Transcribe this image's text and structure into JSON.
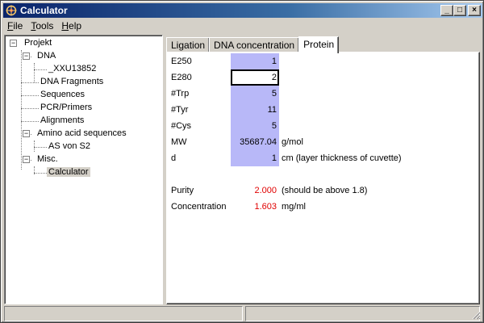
{
  "window": {
    "title": "Calculator",
    "app_icon": "calculator-app-icon"
  },
  "title_buttons": {
    "minimize": "_",
    "maximize": "□",
    "close": "×"
  },
  "menu": [
    {
      "label": "File",
      "accel": "F",
      "rest": "ile"
    },
    {
      "label": "Tools",
      "accel": "T",
      "rest": "ools"
    },
    {
      "label": "Help",
      "accel": "H",
      "rest": "elp"
    }
  ],
  "tree": {
    "expander_open": "−",
    "items": [
      {
        "label": "Projekt"
      },
      {
        "label": "DNA"
      },
      {
        "label": "_XXU13852"
      },
      {
        "label": "DNA Fragments"
      },
      {
        "label": "Sequences"
      },
      {
        "label": "PCR/Primers"
      },
      {
        "label": "Alignments"
      },
      {
        "label": "Amino acid sequences"
      },
      {
        "label": "AS von S2"
      },
      {
        "label": "Misc."
      },
      {
        "label": "Calculator"
      }
    ]
  },
  "tabs": [
    {
      "label": "Ligation"
    },
    {
      "label": "DNA concentration"
    },
    {
      "label": "Protein"
    }
  ],
  "protein": {
    "params": [
      {
        "label": "E250",
        "value": "1",
        "unit": ""
      },
      {
        "label": "E280",
        "value": "2",
        "unit": ""
      },
      {
        "label": "#Trp",
        "value": "5",
        "unit": ""
      },
      {
        "label": "#Tyr",
        "value": "11",
        "unit": ""
      },
      {
        "label": "#Cys",
        "value": "5",
        "unit": ""
      },
      {
        "label": "MW",
        "value": "35687.04",
        "unit": "g/mol"
      },
      {
        "label": "d",
        "value": "1",
        "unit": "cm (layer thickness of cuvette)"
      }
    ],
    "results": [
      {
        "label": "Purity",
        "value": "2.000",
        "note": "(should be above 1.8)"
      },
      {
        "label": "Concentration",
        "value": "1.603",
        "note": "mg/ml"
      }
    ]
  },
  "colors": {
    "input_cell_bg": "#b8b8f8",
    "result_value": "#e00000",
    "titlebar_start": "#0a246a",
    "titlebar_end": "#a6caf0"
  }
}
